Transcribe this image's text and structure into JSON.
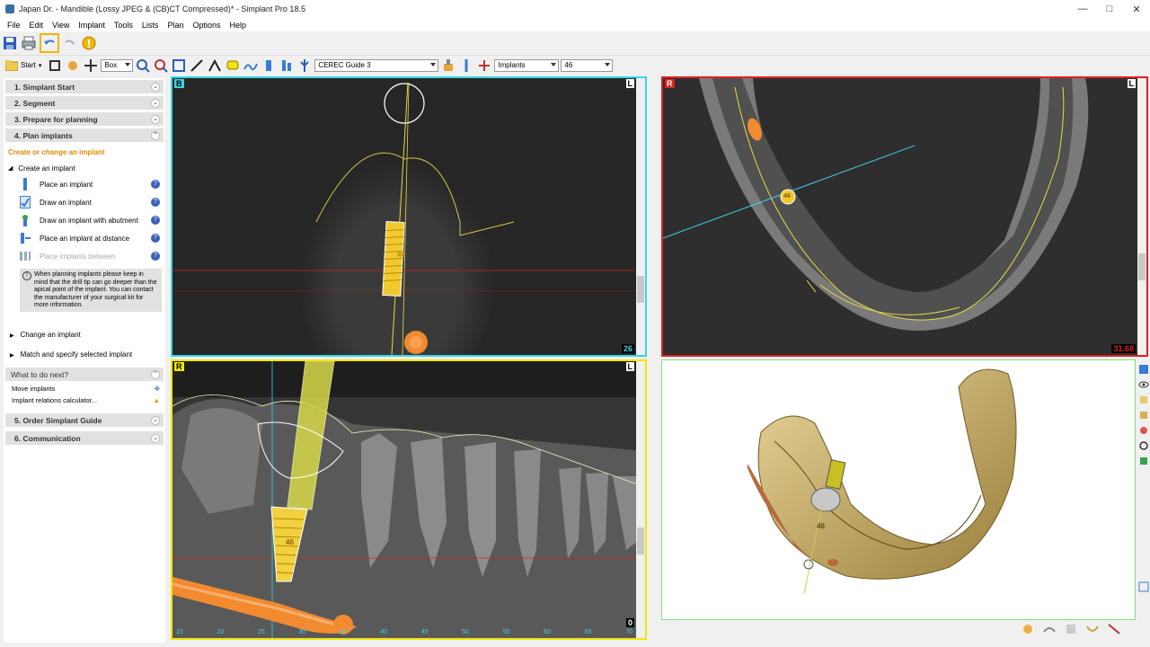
{
  "window": {
    "title": "Japan Dr. - Mandible (Lossy JPEG & (CB)CT Compressed)* - Simplant Pro 18.5"
  },
  "menu": [
    "File",
    "Edit",
    "View",
    "Implant",
    "Tools",
    "Lists",
    "Plan",
    "Options",
    "Help"
  ],
  "toolbar2": {
    "start_label": "Start",
    "box_label": "Box",
    "guide_value": "CEREC Guide 3",
    "implant_type_value": "Implants",
    "implant_num_value": "46"
  },
  "panel": {
    "sections_top": [
      "1. Simplant Start",
      "2. Segment",
      "3. Prepare for planning",
      "4. Plan implants"
    ],
    "active_link": "Create or change an implant",
    "create_header": "Create an implant",
    "items": [
      "Place an implant",
      "Draw an implant",
      "Draw an implant with abutment",
      "Place an implant at distance",
      "Place implants between"
    ],
    "note": "When planning implants please keep in mind that the drill tip can go deeper than the apical point of the implant. You can contact the manufacturer of your surgical kit for more information.",
    "change": "Change an implant",
    "match": "Match and specify selected implant",
    "next_header": "What to do next?",
    "next_items": [
      "Move implants",
      "Implant relations calculator..."
    ],
    "sections_bottom": [
      "5. Order Simplant Guide",
      "6. Communication"
    ]
  },
  "views": {
    "b": {
      "corner": "B",
      "right": "L",
      "num": "26",
      "implant_label": "46"
    },
    "r": {
      "corner": "R",
      "right": "L",
      "num": "31.68",
      "implant_label": "46"
    },
    "p": {
      "corner": "R",
      "right": "L",
      "num": "0",
      "implant_label": "46",
      "ruler": [
        "15",
        "20",
        "25",
        "30",
        "35",
        "40",
        "45",
        "50",
        "55",
        "60",
        "65",
        "70"
      ]
    },
    "d3": {
      "implant_label": "46"
    }
  },
  "colors": {
    "cyan": "#3ad4e6",
    "red": "#e02020",
    "yellow": "#f2e600",
    "green": "#7ee07e"
  }
}
